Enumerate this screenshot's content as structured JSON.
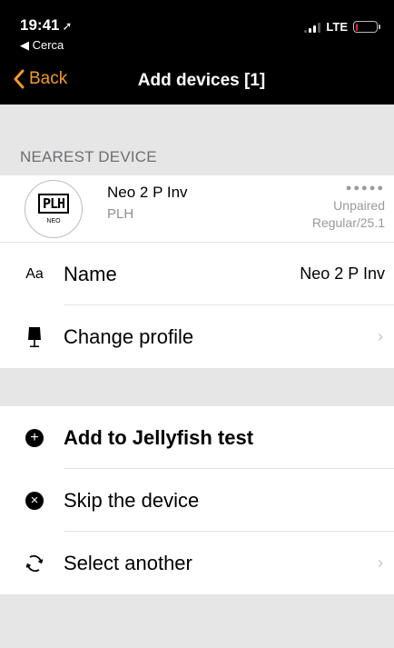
{
  "status_bar": {
    "time": "19:41",
    "location_arrow": "➚",
    "back_app": "◀ Cerca",
    "network": "LTE",
    "battery_level": 0.1,
    "battery_color": "#e8202a"
  },
  "nav": {
    "back_label": "Back",
    "title": "Add devices [1]",
    "accent_color": "#f19a2b"
  },
  "nearest_section": {
    "header": "NEAREST DEVICE"
  },
  "device": {
    "logo_text": "PLH",
    "logo_sub": "NEO",
    "name": "Neo 2 P Inv",
    "brand": "PLH",
    "signal_dots": "●●●●●",
    "status": "Unpaired",
    "mode": "Regular/25.1"
  },
  "settings": {
    "name_icon": "Aa",
    "name_label": "Name",
    "name_value": "Neo 2 P Inv",
    "profile_icon": "lamp-icon",
    "profile_label": "Change profile",
    "chevron": "›"
  },
  "actions": {
    "add_label": "Add to Jellyfish test",
    "add_icon": "+",
    "skip_label": "Skip the device",
    "skip_icon": "×",
    "select_label": "Select another",
    "select_icon": "refresh-icon",
    "chevron": "›"
  }
}
